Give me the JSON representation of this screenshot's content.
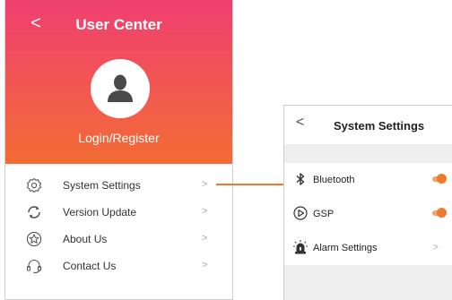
{
  "user_center": {
    "back_glyph": "<",
    "title": "User Center",
    "login_label": "Login/Register",
    "menu": [
      {
        "label": "System Settings",
        "arrow": ">",
        "icon": "gear-icon"
      },
      {
        "label": "Version Update",
        "arrow": ">",
        "icon": "refresh-icon"
      },
      {
        "label": "About Us",
        "arrow": ">",
        "icon": "star-icon"
      },
      {
        "label": "Contact Us",
        "arrow": ">",
        "icon": "headset-icon"
      }
    ],
    "colors": {
      "gradient_top": "#ef3f70",
      "gradient_bottom": "#f36c33"
    }
  },
  "system_settings": {
    "back_glyph": "<",
    "title": "System Settings",
    "items": [
      {
        "label": "Bluetooth",
        "icon": "bluetooth-icon",
        "toggle_on": true
      },
      {
        "label": "GSP",
        "icon": "play-circle-icon",
        "toggle_on": true
      },
      {
        "label": "Alarm Settings",
        "icon": "alarm-siren-icon",
        "arrow": ">"
      }
    ],
    "colors": {
      "accent": "#f07a2c"
    }
  }
}
